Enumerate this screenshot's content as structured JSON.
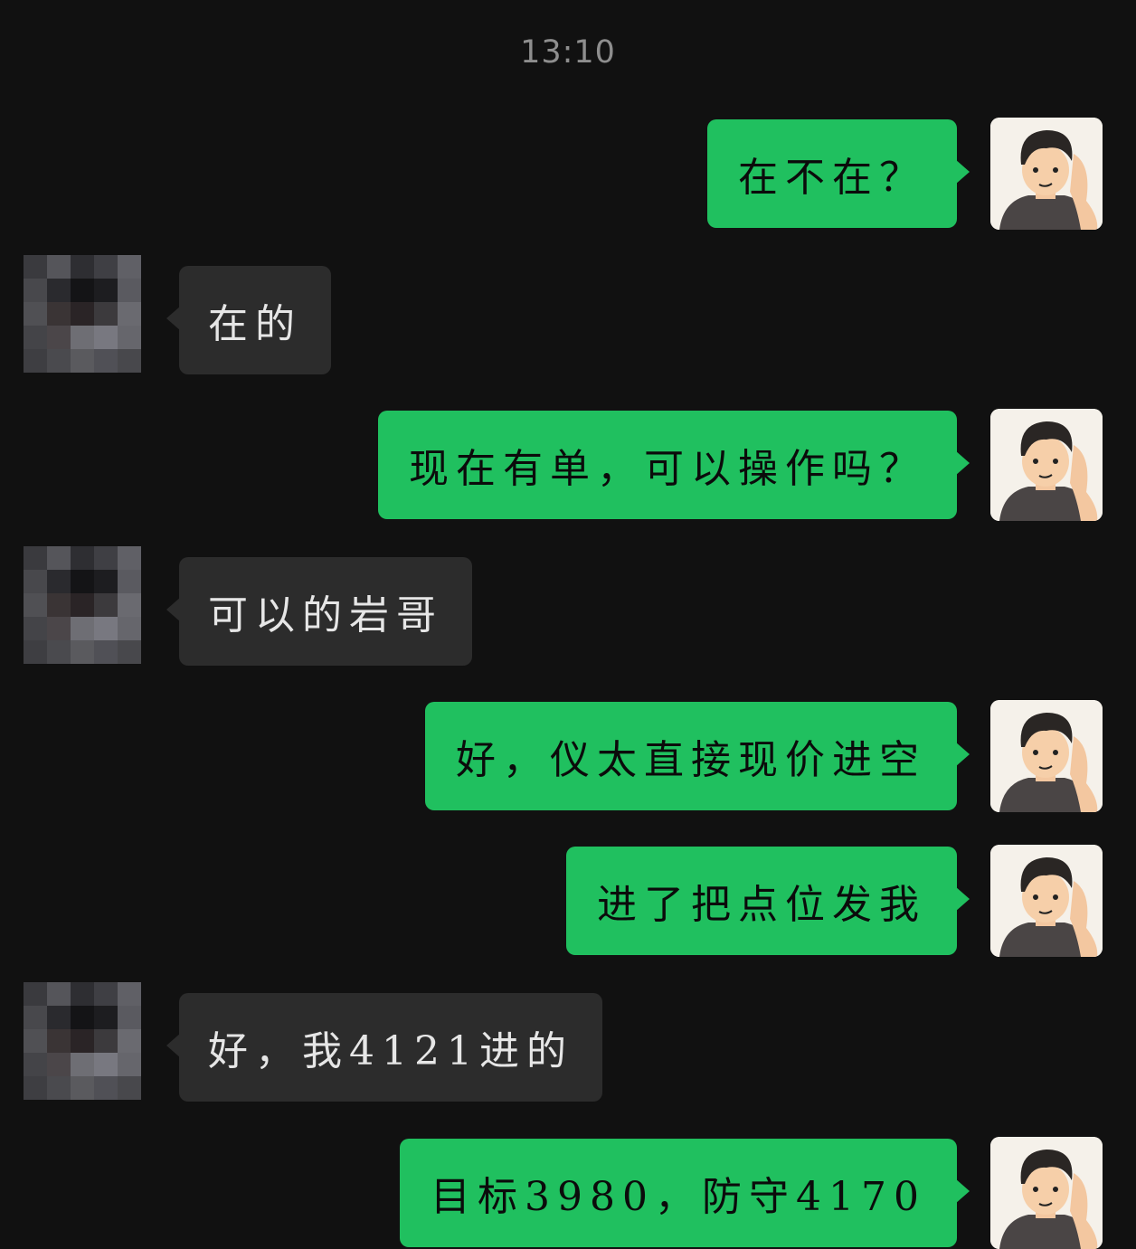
{
  "chat": {
    "timestamp": "13:10",
    "messages": [
      {
        "sender": "me",
        "text": "在不在？"
      },
      {
        "sender": "them",
        "text": "在的"
      },
      {
        "sender": "me",
        "text": "现在有单，可以操作吗？"
      },
      {
        "sender": "them",
        "text": "可以的岩哥"
      },
      {
        "sender": "me",
        "text": "好，仪太直接现价进空"
      },
      {
        "sender": "me",
        "text": "进了把点位发我"
      },
      {
        "sender": "them",
        "text": "好，我4121进的"
      },
      {
        "sender": "me",
        "text": "目标3980，防守4170"
      }
    ]
  },
  "colors": {
    "background": "#111111",
    "my_bubble": "#20c05f",
    "their_bubble": "#2c2c2c",
    "timestamp": "#8e8e8e"
  },
  "icons": {
    "self_avatar": "cartoon-man-avatar-icon",
    "other_avatar": "pixelated-avatar-icon"
  }
}
